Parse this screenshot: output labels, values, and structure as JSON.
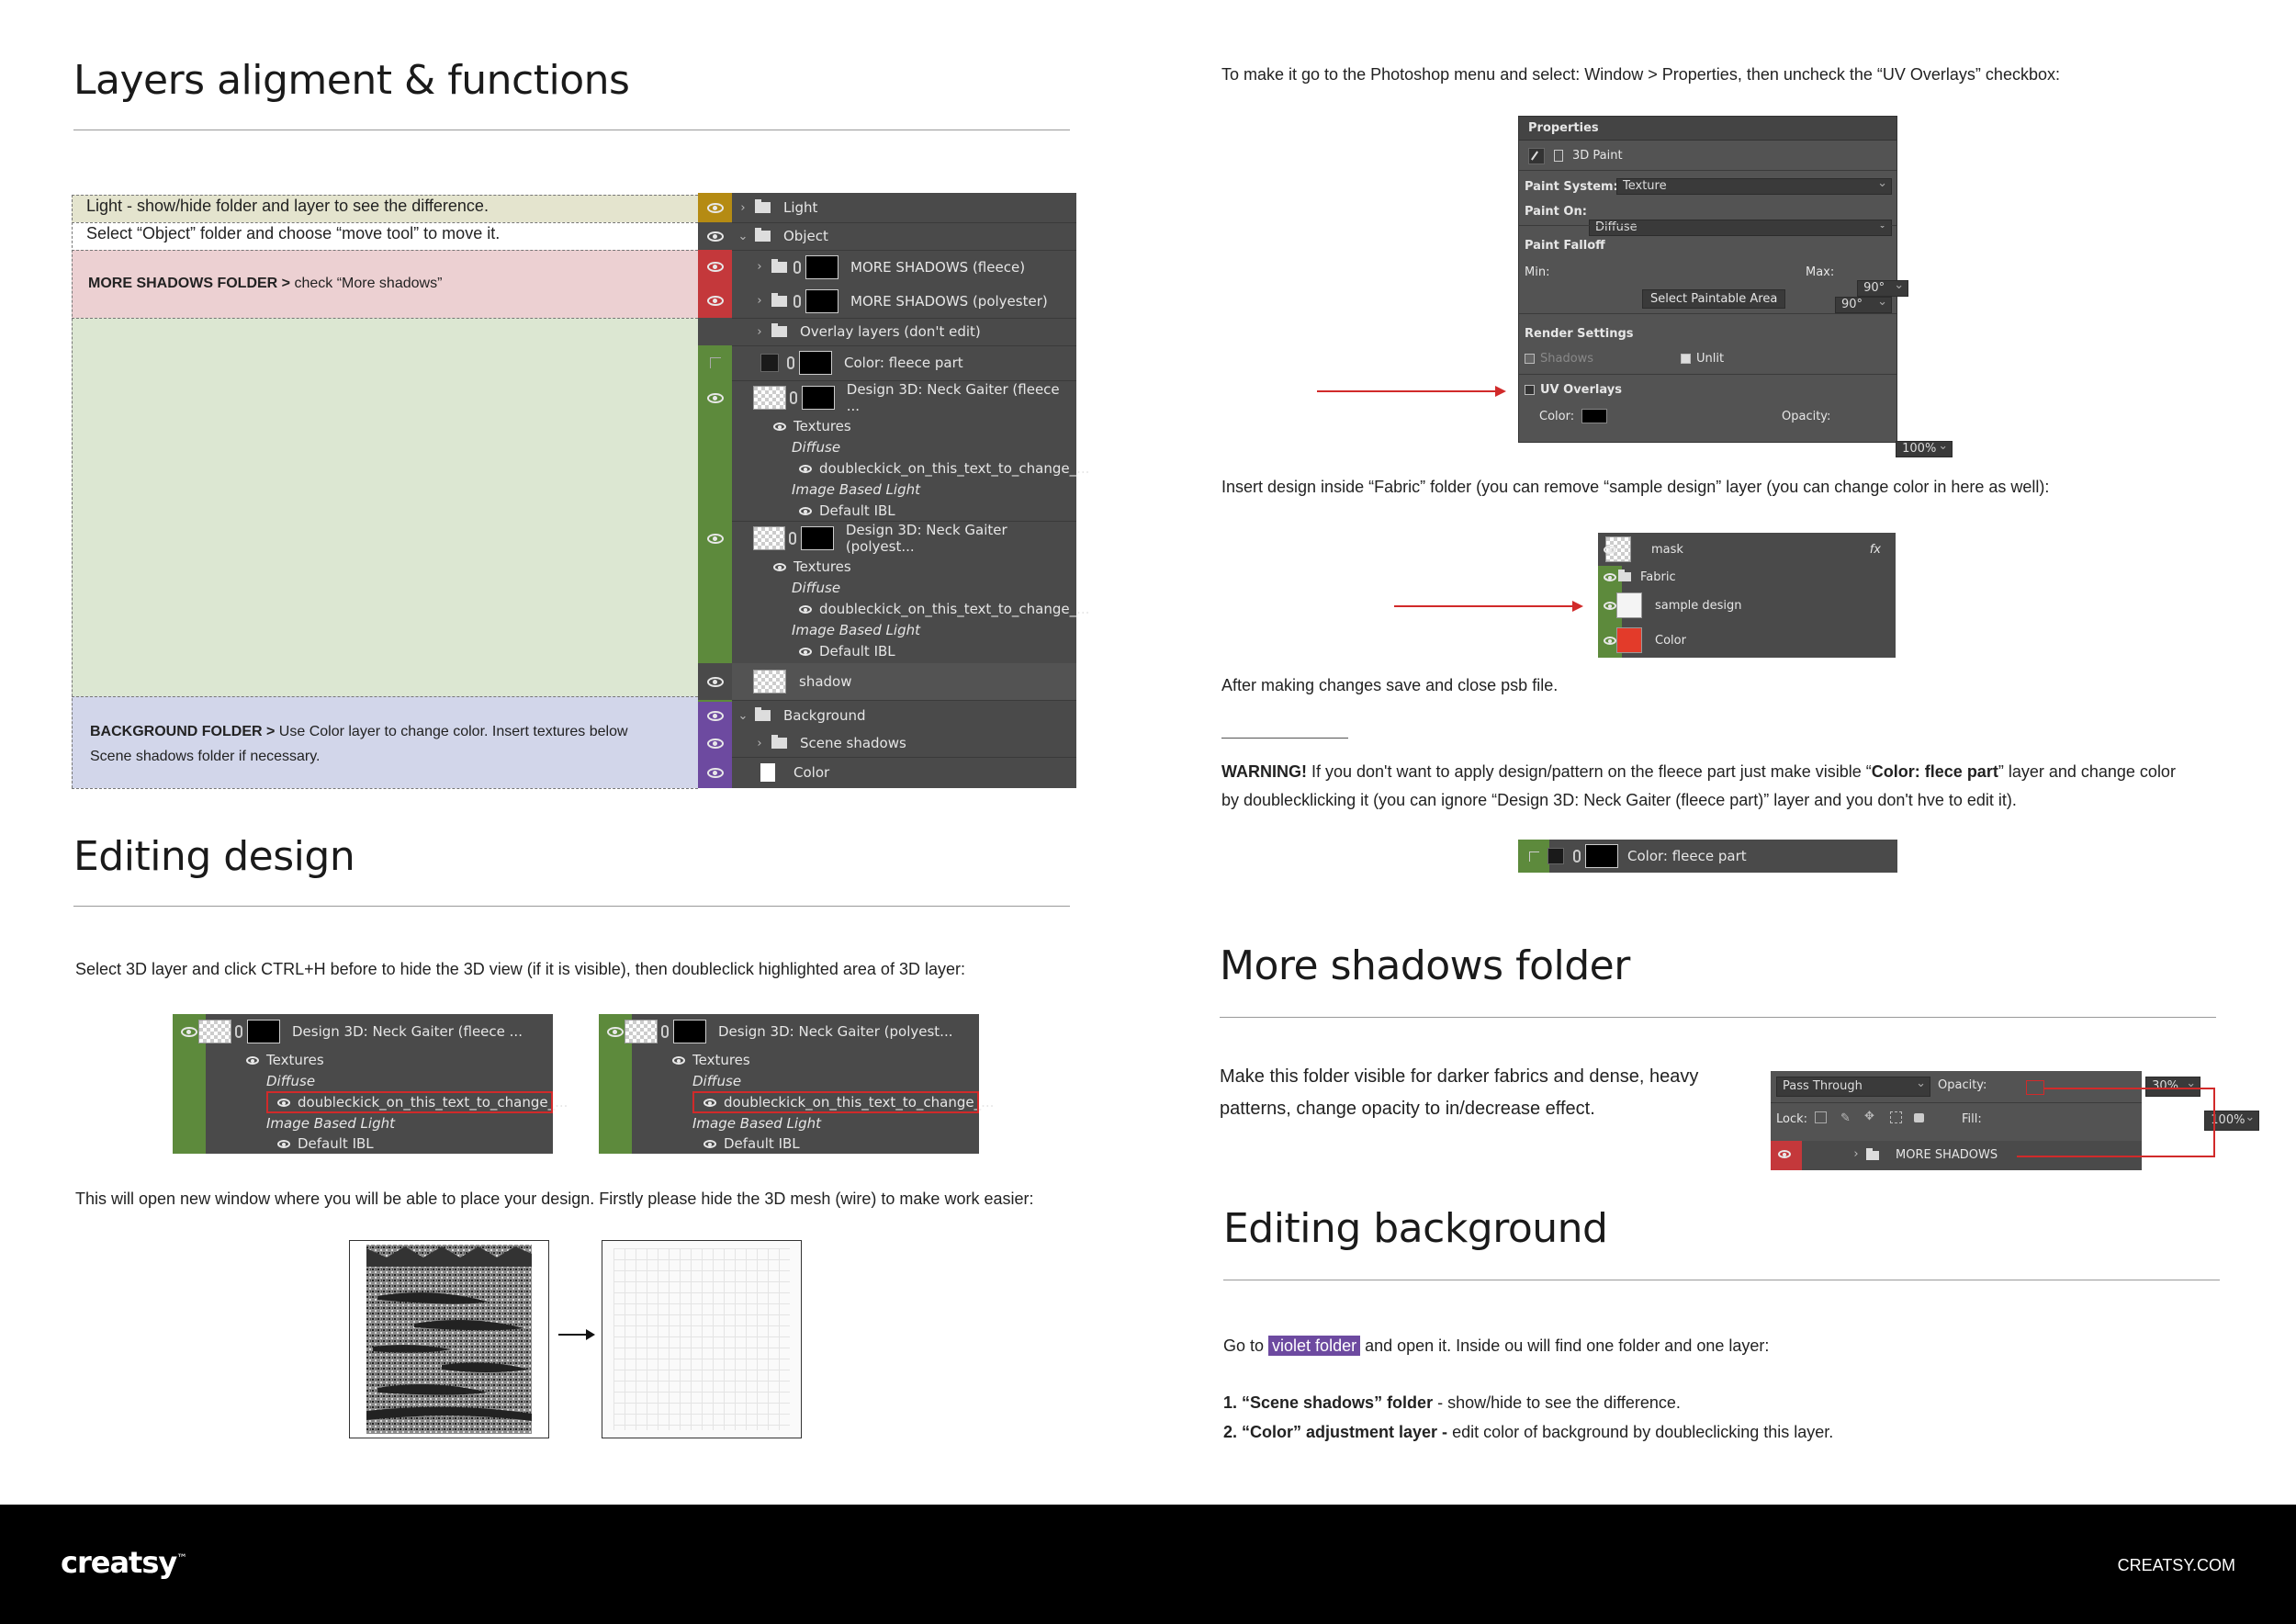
{
  "left": {
    "section1": {
      "title": "Layers aligment & functions"
    },
    "labels": {
      "light": "Light  - show/hide folder and layer to see the difference.",
      "object": "Select “Object” folder and choose “move tool” to move it.",
      "shadows_bold": "MORE SHADOWS FOLDER >",
      "shadows_rest": " check “More shadows”",
      "bg_bold": "BACKGROUND  FOLDER >",
      "bg_rest": " Use Color layer to change color. Insert textures below Scene shadows folder if necessary."
    },
    "layers": {
      "light": "Light",
      "object": "Object",
      "ms_fleece": "MORE SHADOWS (fleece)",
      "ms_poly": "MORE SHADOWS (polyester)",
      "overlay": "Overlay layers (don't edit)",
      "color_fleece": "Color: fleece part",
      "d3_fleece": "Design 3D: Neck Gaiter (fleece ...",
      "textures": "Textures",
      "diffuse": "Diffuse",
      "dbl": "doubleckick_on_this_text_to_change_...",
      "ibl": "Image Based Light",
      "default_ibl": "Default IBL",
      "d3_poly": "Design 3D: Neck Gaiter (polyest...",
      "shadow": "shadow",
      "background": "Background",
      "scene_shadows": "Scene shadows",
      "color": "Color"
    },
    "section2": {
      "title": "Editing design"
    },
    "p1": "Select 3D layer and click CTRL+H before to hide the 3D view (if it is visible), then doubleclick highlighted area of 3D layer:",
    "p2": "This will open new window where you will be able to place your design. Firstly please hide the 3D mesh (wire) to make work easier:"
  },
  "right": {
    "p1": "To make it go to the Photoshop menu and select: Window > Properties, then uncheck the “UV Overlays” checkbox:",
    "props": {
      "title": "Properties",
      "paint": "3D Paint",
      "system_label": "Paint System:",
      "system_value": "Texture",
      "on_label": "Paint On:",
      "on_value": "Diffuse",
      "falloff": "Paint Falloff",
      "min_label": "Min:",
      "min_value": "90°",
      "max_label": "Max:",
      "max_value": "90°",
      "select_btn": "Select Paintable Area",
      "render": "Render Settings",
      "shadows": "Shadows",
      "unlit": "Unlit",
      "uv": "UV Overlays",
      "color_label": "Color:",
      "opacity_label": "Opacity:",
      "opacity_value": "100%"
    },
    "p2": "Insert design inside “Fabric” folder (you can remove “sample design” layer (you can change color in here as well):",
    "fabric": {
      "mask": "mask",
      "fx": "fx",
      "fabric": "Fabric",
      "sample": "sample design",
      "color": "Color"
    },
    "p3": "After making changes save and close psb file.",
    "warning_bold": "WARNING!",
    "warning_a": " If you don't want to apply design/pattern on the fleece part just make visible “",
    "warning_b": "Color: flece part",
    "warning_c": "” layer and change color by doublecklicking it (you can ignore “Design 3D: Neck Gaiter (fleece part)” layer and you don't hve to edit it).",
    "fleece_layer": "Color: fleece part",
    "section3": {
      "title": "More shadows folder"
    },
    "p4": "Make this folder visible for darker fabrics and dense, heavy patterns, change opacity to in/decrease effect.",
    "blend": {
      "mode": "Pass Through",
      "opacity_label": "Opacity:",
      "opacity_value": "30%",
      "lock_label": "Lock:",
      "fill_label": "Fill:",
      "fill_value": "100%",
      "folder": "MORE SHADOWS"
    },
    "section4": {
      "title": "Editing background"
    },
    "goto_a": "Go to ",
    "goto_hl": "violet folder",
    "goto_b": " and open it. Inside ou will find one folder and one layer:",
    "li1_bold": "1. “Scene shadows” folder",
    "li1_rest": " - show/hide to see the difference.",
    "li2_bold": "2. “Color” adjustment layer -",
    "li2_rest": " edit color of background by doubleclicking this layer."
  },
  "footer": {
    "logo": "creatsy",
    "tm": "™",
    "url": "CREATSY.COM"
  },
  "colors": {
    "yellow": "#b58b13",
    "red": "#c4383b",
    "green": "#5d8a3c",
    "violet": "#6d4aa0",
    "panel": "#4a4a4a"
  }
}
